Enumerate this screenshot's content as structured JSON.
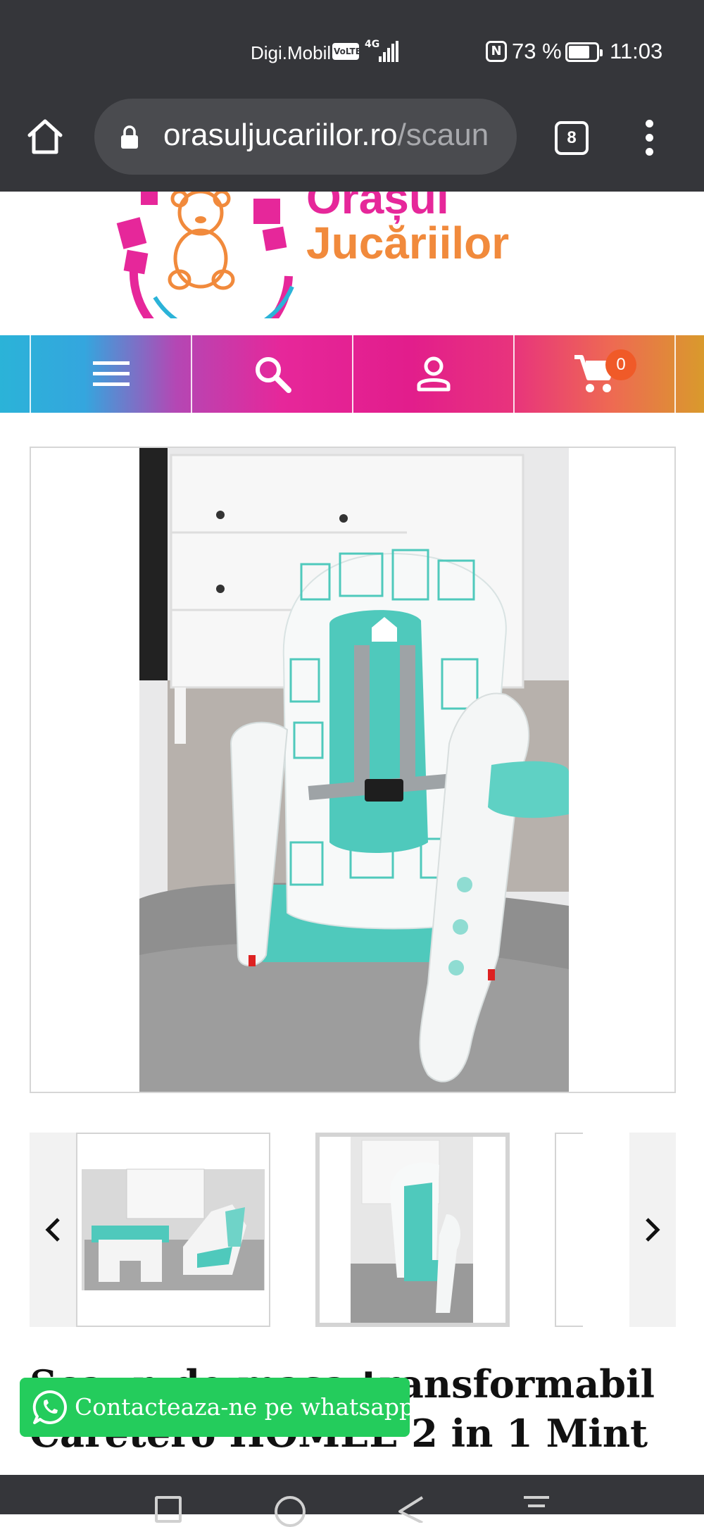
{
  "status_bar": {
    "carrier": "Digi.Mobil",
    "volte": "VoLTE",
    "network": "4G",
    "nfc": "N",
    "battery_percent": "73 %",
    "battery_level": 0.73,
    "time": "11:03"
  },
  "browser": {
    "url_host": "orasuljucariilor.ro",
    "url_path": "/scaun",
    "tab_count": "8",
    "icons": [
      "home-icon",
      "lock-icon",
      "tabs-icon",
      "more-vert-icon"
    ]
  },
  "site": {
    "logo_line1": "Orașul",
    "logo_line2": "Jucăriilor",
    "nav": [
      {
        "icon": "menu-icon"
      },
      {
        "icon": "search-icon"
      },
      {
        "icon": "account-icon"
      },
      {
        "icon": "cart-icon"
      }
    ],
    "cart_count": "0"
  },
  "product": {
    "main_image": "High chair mint with white cushion",
    "thumbnails": [
      "thumb-1",
      "thumb-2",
      "thumb-3"
    ],
    "active_thumbnail": 1,
    "title": "Scaun de masa transformabil Caretero HOMEE 2 in 1 Mint"
  },
  "whatsapp": {
    "label": "Contacteaza-ne pe whatsapp!"
  },
  "colors": {
    "chrome": "#35363a",
    "cart_badge": "#f05a28",
    "whatsapp": "#24cc5c",
    "mint": "#4fc9bc"
  }
}
